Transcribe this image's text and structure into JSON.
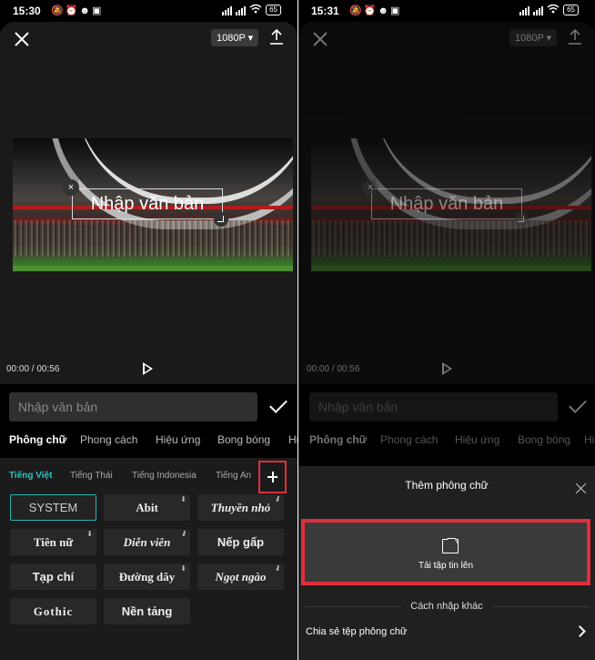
{
  "left": {
    "status": {
      "time": "15:30",
      "battery": "65"
    },
    "editor": {
      "resolution": "1080P",
      "overlay_text": "Nhập văn bản",
      "overlay_close": "×",
      "time_current": "00:00",
      "time_sep": " / ",
      "time_total": "00:56"
    },
    "input": {
      "placeholder": "Nhập văn bản"
    },
    "tabs": [
      "Phông chữ",
      "Phong cách",
      "Hiệu ứng",
      "Bong bóng",
      "Hi"
    ],
    "languages": [
      "Tiếng Việt",
      "Tiếng Thái",
      "Tiếng Indonesia",
      "Tiếng An"
    ],
    "fonts": [
      {
        "label": "SYSTEM",
        "selected": true
      },
      {
        "label": "Abit",
        "download": true
      },
      {
        "label": "Thuyền nhỏ",
        "download": true
      },
      {
        "label": "Tiên nữ",
        "download": true
      },
      {
        "label": "Diễn viên",
        "download": true
      },
      {
        "label": "Nếp gấp",
        "download": false
      },
      {
        "label": "Tạp chí",
        "download": false
      },
      {
        "label": "Đường dây",
        "download": true
      },
      {
        "label": "Ngọt ngào",
        "download": true
      },
      {
        "label": "Gothic",
        "download": false
      },
      {
        "label": "Nền tảng",
        "download": false
      }
    ]
  },
  "right": {
    "status": {
      "time": "15:31",
      "battery": "65"
    },
    "editor": {
      "resolution": "1080P",
      "overlay_text": "Nhập văn bản",
      "overlay_close": "×",
      "time_current": "00:00",
      "time_sep": " / ",
      "time_total": "00:56"
    },
    "input": {
      "placeholder": "Nhập văn bản"
    },
    "tabs": [
      "Phông chữ",
      "Phong cách",
      "Hiệu ứng",
      "Bong bóng",
      "Hi"
    ],
    "sheet": {
      "title": "Thêm phông chữ",
      "upload_label": "Tải tập tin lên",
      "other_label": "Cách nhập khác",
      "share_label": "Chia sẻ tệp phông chữ"
    }
  },
  "colors": {
    "accent_teal": "#29c5c5",
    "highlight_red": "#e02f3c",
    "background": "#000000"
  },
  "icons": {
    "close": "close-icon",
    "upload": "upload-icon",
    "play": "play-icon",
    "check": "check-icon",
    "add": "plus-icon",
    "folder": "folder-icon",
    "chevron": "chevron-right-icon"
  }
}
